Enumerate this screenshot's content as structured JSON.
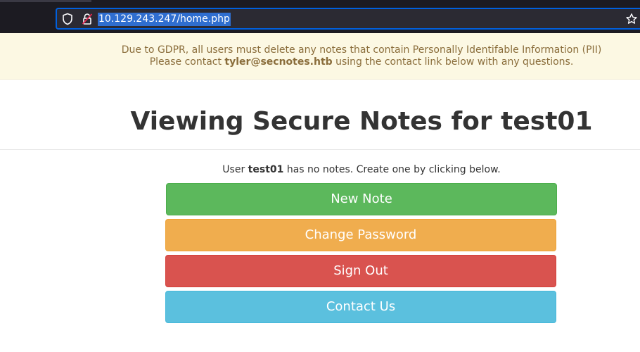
{
  "browser": {
    "url": "10.129.243.247/home.php",
    "icons": {
      "tracking": "shield-icon",
      "security": "insecure-lock-icon",
      "bookmark": "star-icon"
    },
    "colors": {
      "chrome_bg": "#1c1b22",
      "urlbar_focus": "#0060df",
      "selection": "#2f6ecf"
    }
  },
  "banner": {
    "line1": "Due to GDPR, all users must delete any notes that contain Personally Identifable Information (PII)",
    "line2_prefix": "Please contact ",
    "email": "tyler@secnotes.htb",
    "line2_suffix": " using the contact link below with any questions.",
    "colors": {
      "bg": "#fcf8e3",
      "text": "#8a6d3b"
    }
  },
  "heading": {
    "prefix": "Viewing Secure Notes for ",
    "username": "test01"
  },
  "notes_status": {
    "prefix": "User ",
    "username": "test01",
    "suffix": " has no notes. Create one by clicking below."
  },
  "actions": {
    "new_note": "New Note",
    "change_password": "Change Password",
    "sign_out": "Sign Out",
    "contact_us": "Contact Us"
  },
  "colors": {
    "new_note": "#5cb85c",
    "change_password": "#f0ad4e",
    "sign_out": "#d9534f",
    "contact_us": "#5bc0de"
  }
}
